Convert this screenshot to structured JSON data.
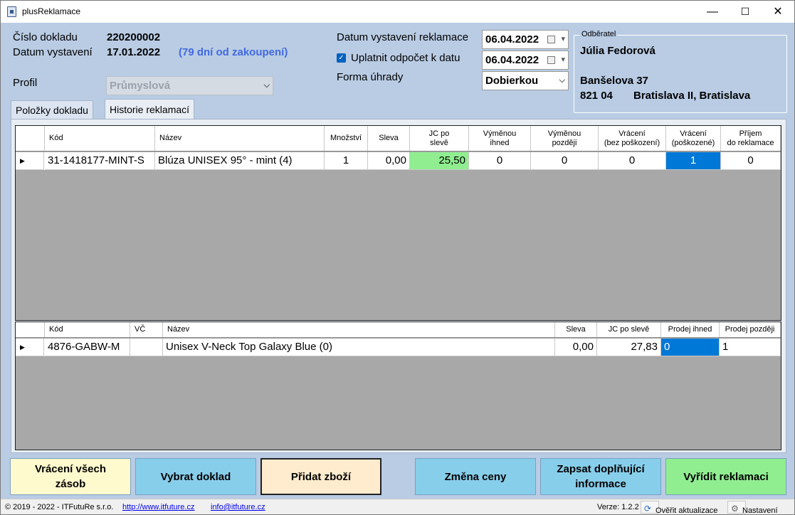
{
  "window": {
    "title": "plusReklamace",
    "min": "—",
    "max": "☐",
    "close": "✕"
  },
  "doc": {
    "number_label": "Číslo dokladu",
    "number_value": "220200002",
    "date_label": "Datum vystavení",
    "date_value": "17.01.2022",
    "days_note": "(79 dní od zakoupení)",
    "profile_label": "Profil",
    "profile_value": "Průmyslová"
  },
  "claim": {
    "date_label": "Datum vystavení reklamace",
    "date_value": "06.04.2022",
    "apply_label": "Uplatnit odpočet k datu",
    "apply_date": "06.04.2022",
    "apply_checked": "✓",
    "payment_label": "Forma úhrady",
    "payment_value": "Dobierkou"
  },
  "customer": {
    "group_label": "Odběratel",
    "name": "Júlia Fedorová",
    "street": "Banšelova 37",
    "zip": "821 04",
    "city": "Bratislava II, Bratislava"
  },
  "tabs": [
    {
      "label": "Položky dokladu"
    },
    {
      "label": "Historie reklamací"
    }
  ],
  "grid1": {
    "headers": [
      "Kód",
      "Název",
      "Množství",
      "Sleva",
      "JC po\nslevě",
      "Výměnou\nihned",
      "Výměnou\npozději",
      "Vrácení\n(bez poškození)",
      "Vrácení\n(poškozené)",
      "Příjem\ndo reklamace"
    ],
    "rows": [
      {
        "marker": "▶",
        "code": "31-1418177-MINT-S",
        "name": "Blúza UNISEX 95° - mint (4)",
        "qty": "1",
        "discount": "0,00",
        "price": "25,50",
        "ex_now": "0",
        "ex_later": "0",
        "ret_ok": "0",
        "ret_damaged": "1",
        "intake": "0"
      }
    ],
    "price_color": "#90ee90"
  },
  "grid2": {
    "headers": [
      "Kód",
      "VČ",
      "Název",
      "Sleva",
      "JC po slevě",
      "Prodej ihned",
      "Prodej později"
    ],
    "rows": [
      {
        "marker": "▶",
        "code": "4876-GABW-M",
        "vc": "",
        "name": "Unisex V-Neck Top Galaxy Blue (0)",
        "discount": "0,00",
        "price": "27,83",
        "sell_now": "0",
        "sell_later": "1"
      }
    ]
  },
  "buttons": {
    "return_all": "Vrácení všech zásob",
    "select_doc": "Vybrat doklad",
    "add_goods": "Přidat zboží",
    "change_price": "Změna ceny",
    "write_info": "Zapsat doplňující informace",
    "resolve": "Vyřídit reklamaci"
  },
  "status": {
    "copyright": "© 2019 - 2022 - ITFutuRe s.r.o.",
    "web": "http://www.itfuture.cz",
    "email": "info@itfuture.cz",
    "version": "Verze: 1.2.2",
    "check_update": "Ověřit aktualizace",
    "settings": "Nastavení"
  }
}
